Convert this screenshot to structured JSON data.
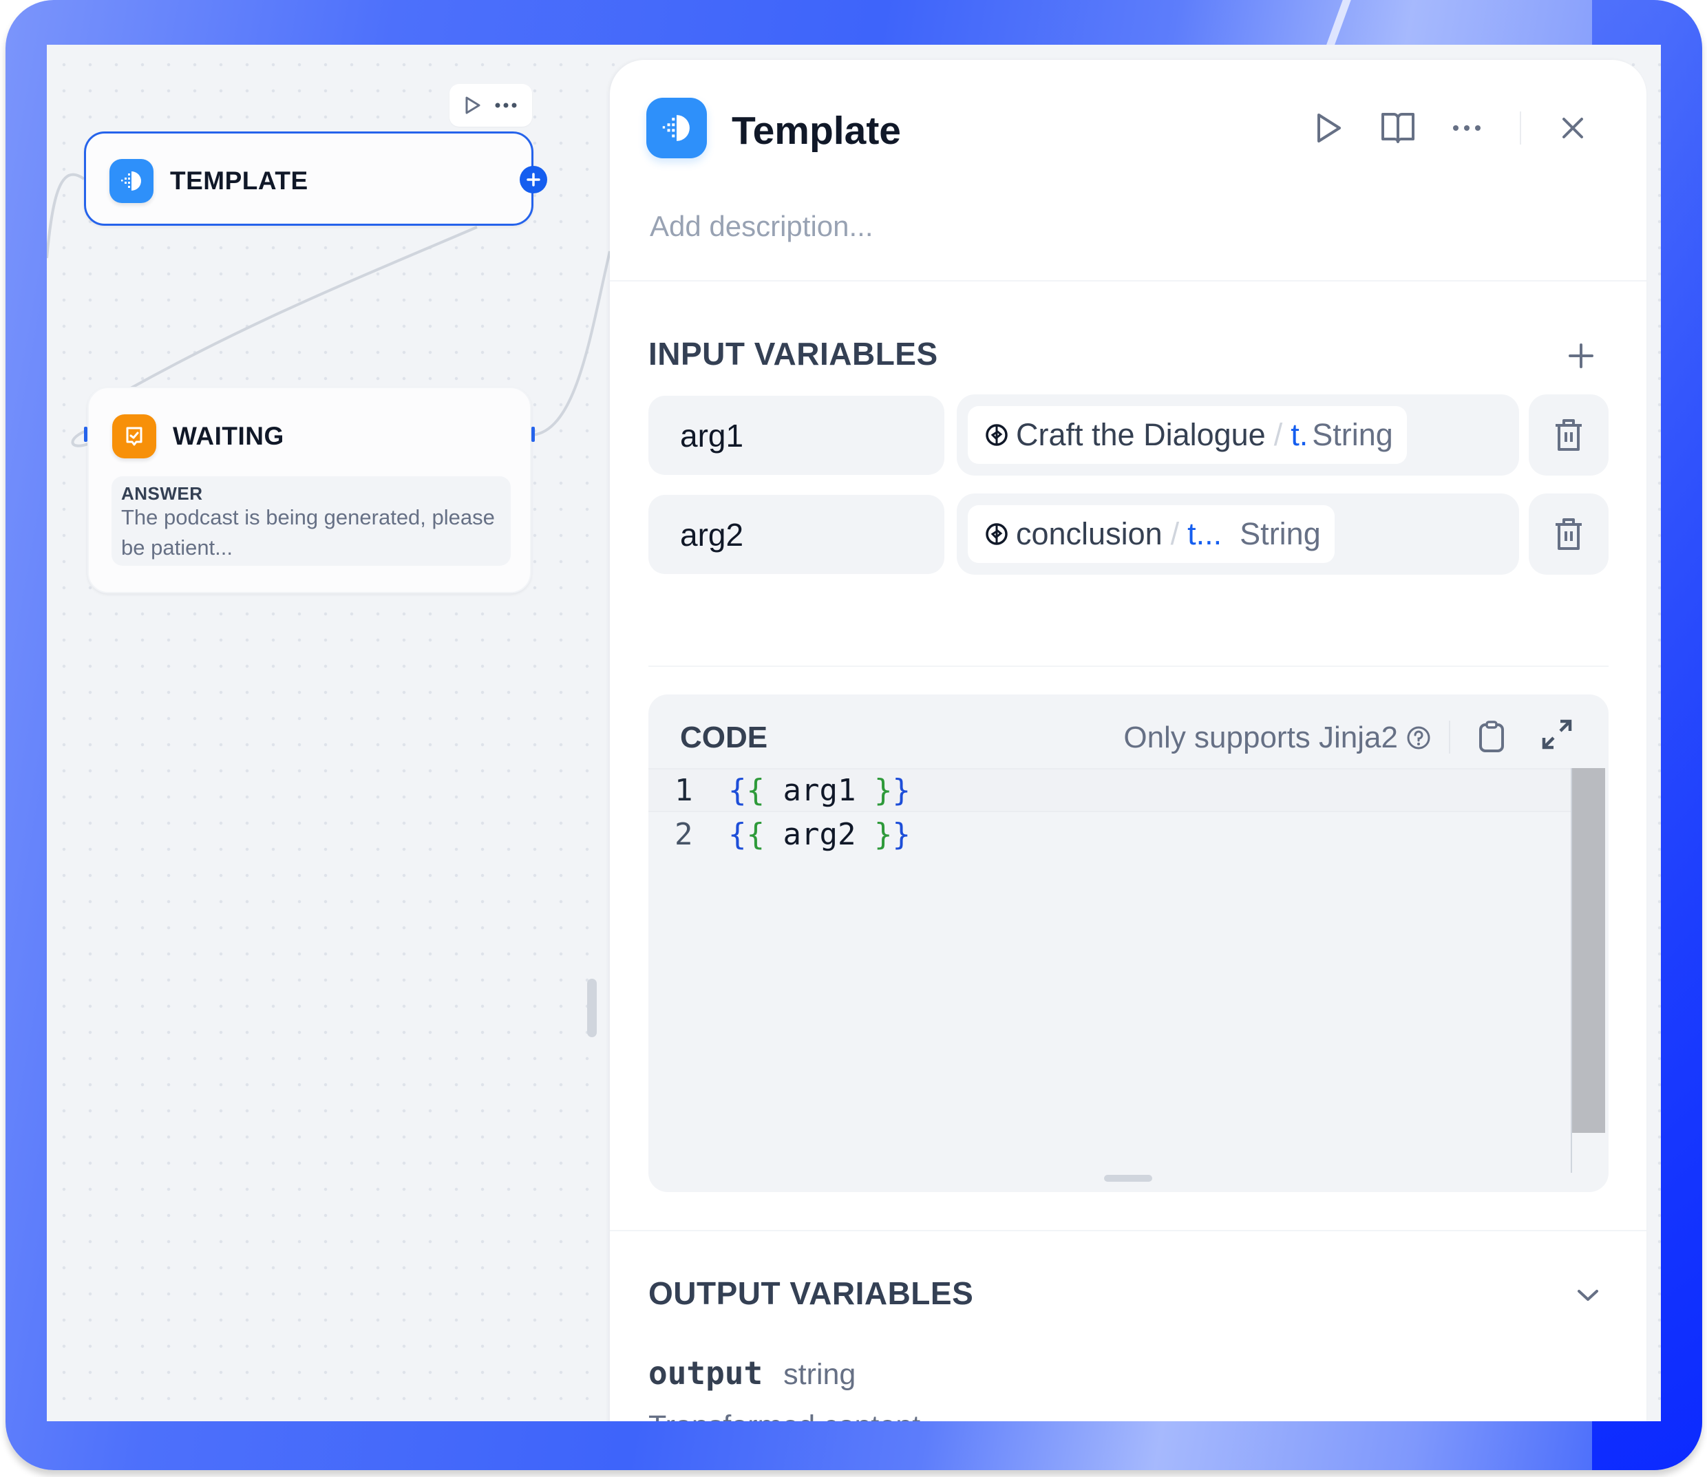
{
  "canvas": {
    "node_toolbar": {
      "run_icon": "play-icon",
      "more_icon": "more-horizontal-icon"
    },
    "nodes": [
      {
        "id": "template",
        "title": "TEMPLATE",
        "icon": "template-transform-icon",
        "icon_color": "#2e90fa",
        "selected": true
      },
      {
        "id": "waiting",
        "title": "WAITING",
        "icon": "answer-message-icon",
        "icon_color": "#f79009",
        "answer_label": "ANSWER",
        "answer_text": "The podcast is being generated, please be patient..."
      }
    ]
  },
  "panel": {
    "title": "Template",
    "icon": "template-transform-icon",
    "actions": {
      "run": "play-icon",
      "docs": "book-open-icon",
      "more": "more-horizontal-icon",
      "close": "close-icon"
    },
    "description_placeholder": "Add description...",
    "input_variables": {
      "title": "INPUT VARIABLES",
      "add_icon": "plus-icon",
      "rows": [
        {
          "name": "arg1",
          "source_node": "Craft the Dialogue",
          "source_var": "t.",
          "type": "String"
        },
        {
          "name": "arg2",
          "source_node": "conclusion",
          "source_var": "t...",
          "type": "String"
        }
      ]
    },
    "code": {
      "title": "CODE",
      "hint": "Only supports Jinja2",
      "lines": [
        {
          "number": "1",
          "open": "{{",
          "var": "arg1",
          "close": "}}"
        },
        {
          "number": "2",
          "open": "{{",
          "var": "arg2",
          "close": "}}"
        }
      ]
    },
    "output_variables": {
      "title": "OUTPUT VARIABLES",
      "items": [
        {
          "name": "output",
          "type": "string",
          "description": "Transformed content"
        }
      ]
    }
  },
  "colors": {
    "accent": "#155eef",
    "selected_border": "#2563eb",
    "template_icon": "#2e90fa",
    "answer_icon": "#f79009",
    "bracket_outer": "#1d4ed8",
    "bracket_inner": "#2e9a3a"
  }
}
